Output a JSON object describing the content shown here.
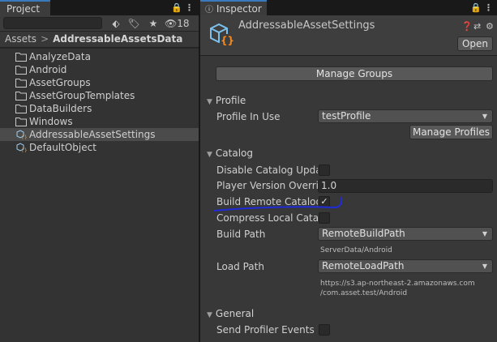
{
  "project_panel": {
    "tab_title": "Project",
    "hidden_count": "18",
    "breadcrumb": {
      "root": "Assets",
      "separator": ">",
      "current": "AddressableAssetsData"
    },
    "items": [
      {
        "label": "AnalyzeData",
        "icon": "folder-icon"
      },
      {
        "label": "Android",
        "icon": "folder-icon"
      },
      {
        "label": "AssetGroups",
        "icon": "folder-icon"
      },
      {
        "label": "AssetGroupTemplates",
        "icon": "folder-icon"
      },
      {
        "label": "DataBuilders",
        "icon": "folder-icon"
      },
      {
        "label": "Windows",
        "icon": "folder-icon"
      },
      {
        "label": "AddressableAssetSettings",
        "icon": "scriptable-object-icon",
        "selected": true
      },
      {
        "label": "DefaultObject",
        "icon": "scriptable-object-icon"
      }
    ]
  },
  "inspector": {
    "tab_title": "Inspector",
    "asset_title": "AddressableAssetSettings",
    "open_label": "Open",
    "manage_groups_label": "Manage Groups",
    "profile": {
      "section": "Profile",
      "profile_in_use_label": "Profile In Use",
      "profile_in_use_value": "testProfile",
      "manage_profiles_label": "Manage Profiles"
    },
    "catalog": {
      "section": "Catalog",
      "disable_catalog_update_label": "Disable Catalog Updat",
      "disable_catalog_update_checked": false,
      "player_version_override_label": "Player Version Overrid",
      "player_version_override_value": "1.0",
      "build_remote_catalog_label": "Build Remote Catalog",
      "build_remote_catalog_checked": true,
      "compress_local_catalog_label": "Compress Local Catal",
      "compress_local_catalog_checked": false,
      "build_path_label": "Build Path",
      "build_path_value": "RemoteBuildPath",
      "build_path_resolved": "ServerData/Android",
      "load_path_label": "Load Path",
      "load_path_value": "RemoteLoadPath",
      "load_path_resolved_line1": "https://s3.ap-northeast-2.amazonaws.com",
      "load_path_resolved_line2": "/com.asset.test/Android"
    },
    "general": {
      "section": "General",
      "send_profiler_events_label": "Send Profiler Events",
      "send_profiler_events_checked": false
    },
    "check_glyph": "✓"
  },
  "colors": {
    "tab_accent": "#3a79bb",
    "annotation_ink": "#1f2bd8",
    "so_icon": "#4aa3df"
  }
}
